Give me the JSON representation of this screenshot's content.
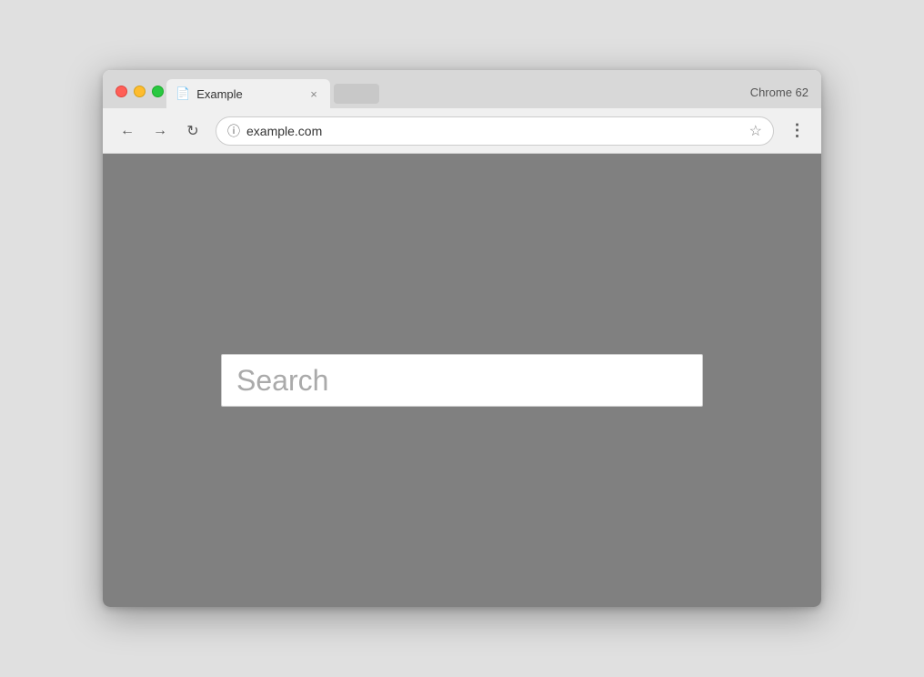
{
  "browser": {
    "chrome_version": "Chrome 62",
    "tab": {
      "title": "Example",
      "icon": "📄"
    },
    "address_bar": {
      "url": "example.com",
      "info_icon": "ⓘ"
    },
    "buttons": {
      "back": "←",
      "forward": "→",
      "reload": "↻",
      "star": "☆",
      "menu": "⋮",
      "close": "×"
    }
  },
  "page": {
    "search_placeholder": "Search"
  }
}
